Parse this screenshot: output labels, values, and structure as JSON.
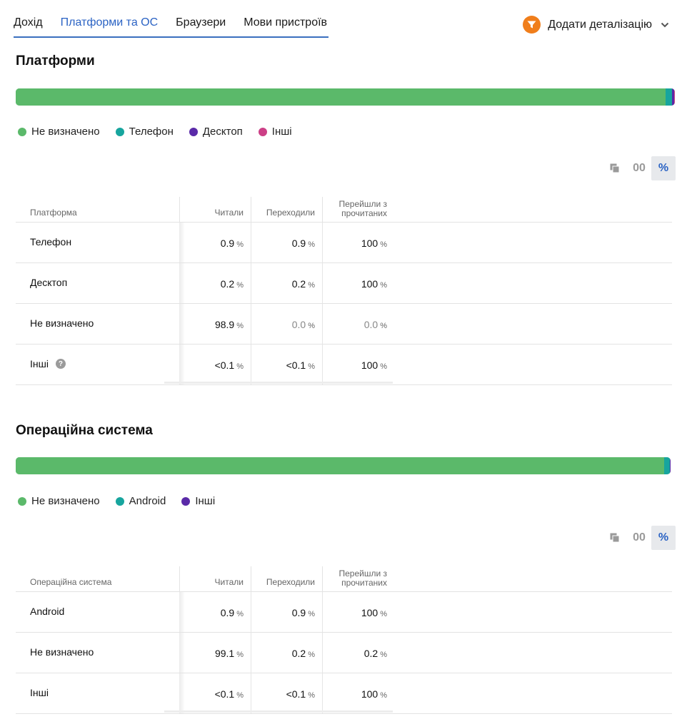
{
  "tabs": [
    {
      "label": "Дохід",
      "active": false
    },
    {
      "label": "Платформи та ОС",
      "active": true
    },
    {
      "label": "Браузери",
      "active": false
    },
    {
      "label": "Мови пристроїв",
      "active": false
    }
  ],
  "add_detail": {
    "label": "Додати деталізацію",
    "icon": "funnel-icon",
    "chevron": "chevron-down-icon"
  },
  "colors": {
    "undefined": "#5bb96a",
    "phone": "#17a59e",
    "desktop": "#5a2aa8",
    "other": "#cc3f86",
    "accent": "#2b63c4",
    "funnel": "#f07e1b"
  },
  "units": {
    "percent": "%"
  },
  "toolbar": {
    "abs_label": "00",
    "pct_label": "%",
    "copy_icon": "copy-icon"
  },
  "platforms": {
    "title": "Платформи",
    "share": {
      "undefined": 98.9,
      "phone": 0.9,
      "desktop": 0.2,
      "other": 0.0
    },
    "legend": [
      {
        "label": "Не визначено",
        "color": "#5bb96a"
      },
      {
        "label": "Телефон",
        "color": "#17a59e"
      },
      {
        "label": "Десктоп",
        "color": "#5a2aa8"
      },
      {
        "label": "Інші",
        "color": "#cc3f86"
      }
    ],
    "headers": {
      "name": "Платформа",
      "read": "Читали",
      "clicked": "Переходили",
      "conversion_1": "Перейшли з",
      "conversion_2": "прочитаних"
    },
    "rows": [
      {
        "name": "Телефон",
        "read": "0.9",
        "clicked": "0.9",
        "conversion": "100"
      },
      {
        "name": "Десктоп",
        "read": "0.2",
        "clicked": "0.2",
        "conversion": "100"
      },
      {
        "name": "Не визначено",
        "read": "98.9",
        "clicked": "0.0",
        "conversion": "0.0"
      },
      {
        "name": "Інші",
        "read": "<0.1",
        "clicked": "<0.1",
        "conversion": "100",
        "help_icon": "help-icon"
      }
    ]
  },
  "os": {
    "title": "Операційна система",
    "share": {
      "undefined": 99.1,
      "android": 0.9,
      "other": 0.0
    },
    "legend": [
      {
        "label": "Не визначено",
        "color": "#5bb96a"
      },
      {
        "label": "Android",
        "color": "#17a59e"
      },
      {
        "label": "Інші",
        "color": "#5a2aa8"
      }
    ],
    "headers": {
      "name": "Операційна система",
      "read": "Читали",
      "clicked": "Переходили",
      "conversion_1": "Перейшли з",
      "conversion_2": "прочитаних"
    },
    "rows": [
      {
        "name": "Android",
        "read": "0.9",
        "clicked": "0.9",
        "conversion": "100"
      },
      {
        "name": "Не визначено",
        "read": "99.1",
        "clicked": "0.2",
        "conversion": "0.2"
      },
      {
        "name": "Інші",
        "read": "<0.1",
        "clicked": "<0.1",
        "conversion": "100"
      }
    ]
  }
}
